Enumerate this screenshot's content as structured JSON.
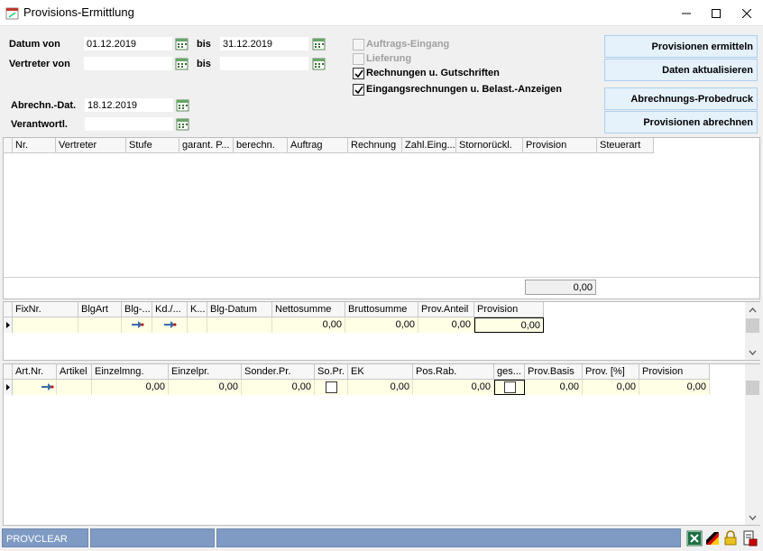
{
  "window": {
    "title": "Provisions-Ermittlung"
  },
  "form": {
    "datum_von_label": "Datum von",
    "datum_von_value": "01.12.2019",
    "bis_label_1": "bis",
    "datum_bis_value": "31.12.2019",
    "vertreter_von_label": "Vertreter von",
    "vertreter_von_value": "",
    "bis_label_2": "bis",
    "vertreter_bis_value": "",
    "abrechn_dat_label": "Abrechn.-Dat.",
    "abrechn_dat_value": "18.12.2019",
    "verantwortl_label": "Verantwortl.",
    "verantwortl_value": ""
  },
  "checkboxes": [
    {
      "label": "Auftrags-Eingang",
      "checked": false,
      "disabled": true
    },
    {
      "label": "Lieferung",
      "checked": false,
      "disabled": true
    },
    {
      "label": "Rechnungen u. Gutschriften",
      "checked": true,
      "disabled": false
    },
    {
      "label": "Eingangsrechnungen u. Belast.-Anzeigen",
      "checked": true,
      "disabled": false
    }
  ],
  "actions": {
    "ermitteln": "Provisionen ermitteln",
    "aktualisieren": "Daten aktualisieren",
    "probedruck": "Abrechnungs-Probedruck",
    "abrechnen": "Provisionen abrechnen"
  },
  "grid1": {
    "columns": [
      "Nr.",
      "Vertreter",
      "Stufe",
      "garant. P...",
      "berechn.",
      "Auftrag",
      "Rechnung",
      "Zahl.Eing...",
      "Stornorückl.",
      "Provision",
      "Steuerart"
    ],
    "total": "0,00"
  },
  "grid2": {
    "columns": [
      "FixNr.",
      "BlgArt",
      "Blg-...",
      "Kd./...",
      "K...",
      "Blg-Datum",
      "Nettosumme",
      "Bruttosumme",
      "Prov.Anteil",
      "Provision"
    ],
    "row": {
      "nettosumme": "0,00",
      "bruttosumme": "0,00",
      "prov_anteil": "0,00",
      "provision": "0,00"
    }
  },
  "grid3": {
    "columns": [
      "Art.Nr.",
      "Artikel",
      "Einzelmng.",
      "Einzelpr.",
      "Sonder.Pr.",
      "So.Pr.",
      "EK",
      "Pos.Rab.",
      "ges...",
      "Prov.Basis",
      "Prov. [%]",
      "Provision"
    ],
    "row": {
      "einzelmng": "0,00",
      "einzelpr": "0,00",
      "sonder_pr": "0,00",
      "ek": "0,00",
      "pos_rab": "0,00",
      "prov_basis": "0,00",
      "prov_pct": "0,00",
      "provision": "0,00"
    }
  },
  "status": {
    "panel1": "PROVCLEAR"
  },
  "colors": {
    "status_panel": "#7f9bc4",
    "row_highlight": "#ffffe6",
    "button_bg": "#e5f1fb"
  }
}
